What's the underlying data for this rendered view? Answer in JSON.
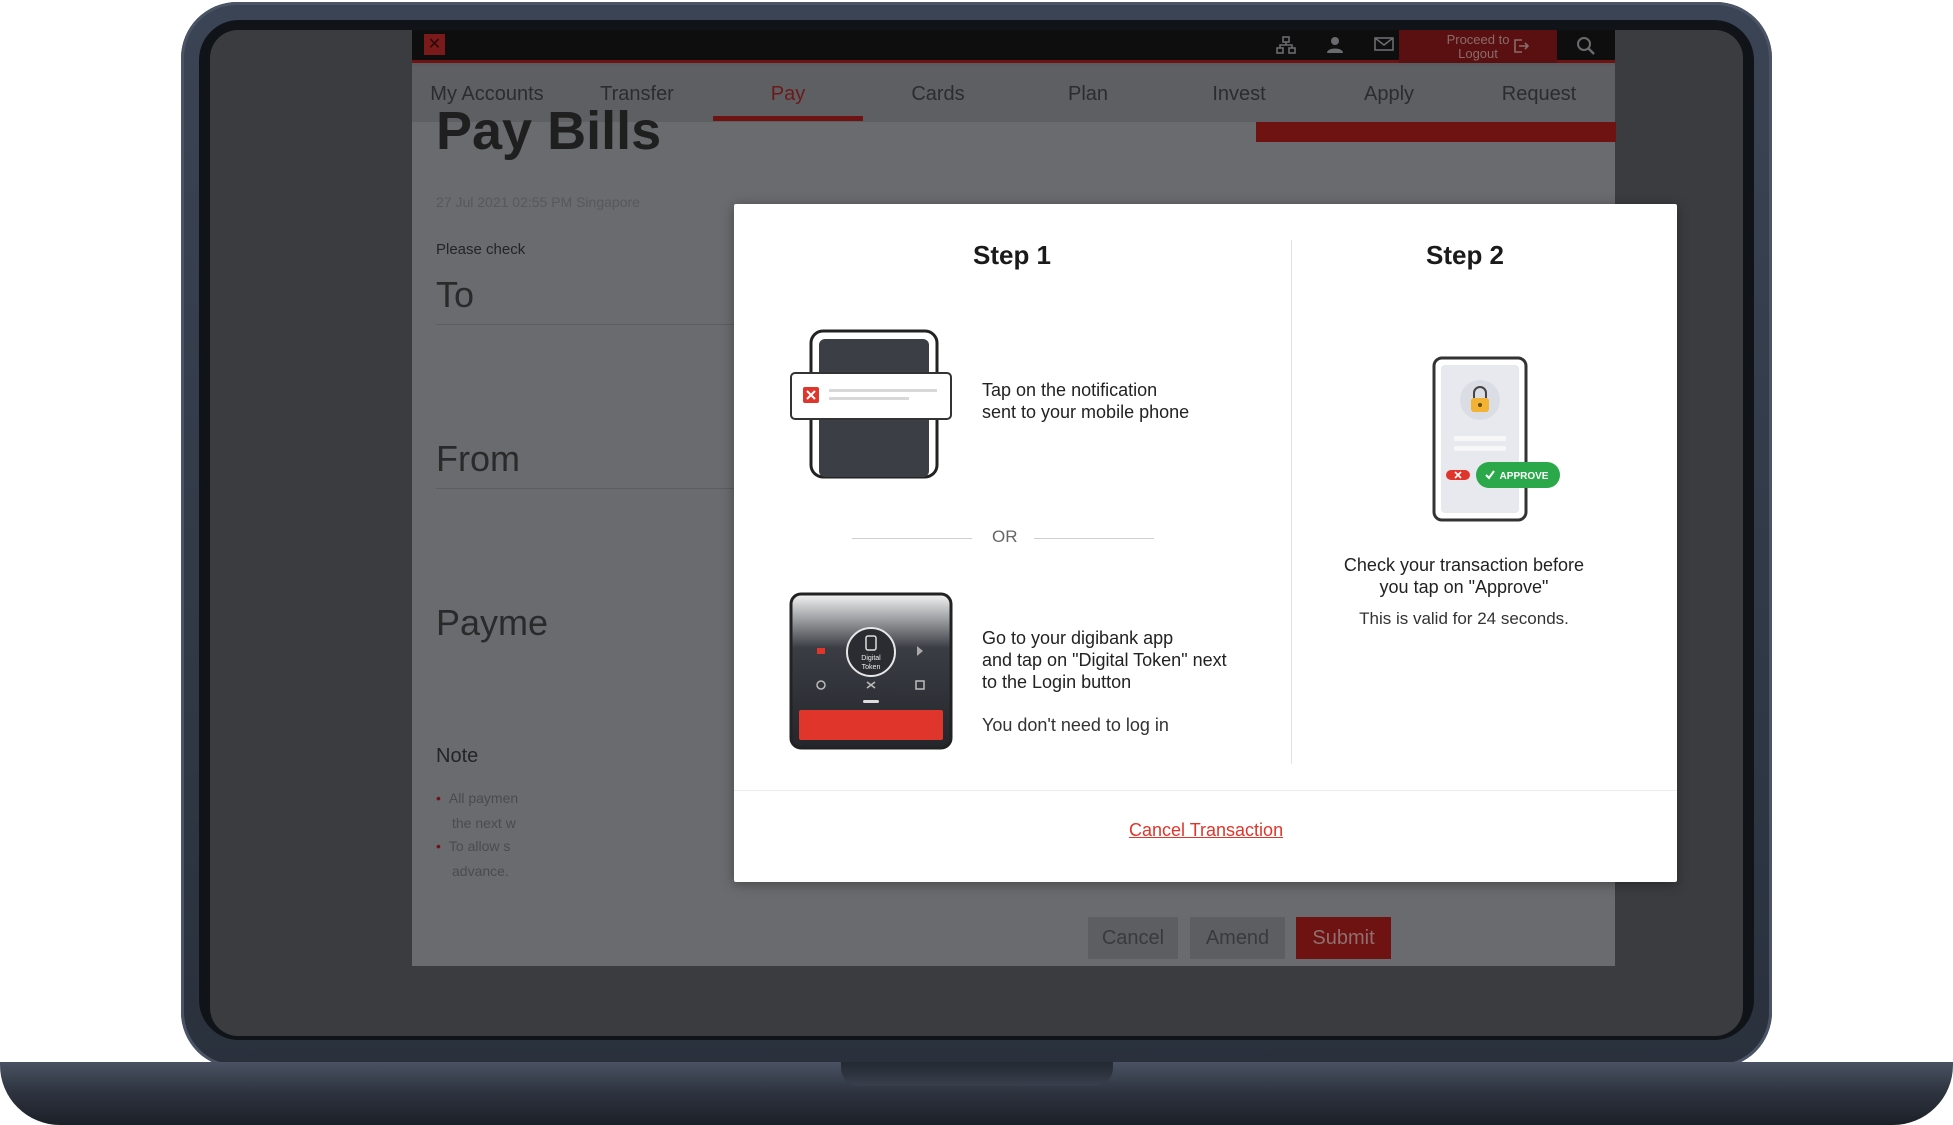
{
  "nav": {
    "items": [
      "My Accounts",
      "Transfer",
      "Pay",
      "Cards",
      "Plan",
      "Invest",
      "Apply",
      "Request"
    ],
    "active": "Pay"
  },
  "topbar": {
    "logout_label": "Proceed to Logout"
  },
  "page": {
    "title": "Pay Bills",
    "timestamp": "27 Jul 2021 02:55 PM Singapore",
    "check_text": "Please check",
    "to_label": "To",
    "from_label": "From",
    "payment_label": "Payme",
    "note_label": "Note",
    "note_bullet_1a": "All paymen",
    "note_bullet_1b": "the next w",
    "note_bullet_2a": "To allow s",
    "note_bullet_2b": "advance.",
    "cancel_label": "Cancel",
    "amend_label": "Amend",
    "submit_label": "Submit"
  },
  "modal": {
    "step1_title": "Step 1",
    "step2_title": "Step 2",
    "step1_instr_line1": "Tap on the notification",
    "step1_instr_line2": "sent to your mobile phone",
    "or_label": "OR",
    "step1_alt_line1": "Go to your digibank app",
    "step1_alt_line2": "and tap on \"Digital Token\" next",
    "step1_alt_line3": "to the Login button",
    "step1_alt_note": "You don't need to log in",
    "digital_token_label_1": "Digital",
    "digital_token_label_2": "Token",
    "approve_badge": "APPROVE",
    "step2_line1": "Check your transaction before",
    "step2_line2": "you tap on \"Approve\"",
    "step2_valid": "This is valid for 24 seconds.",
    "cancel_link": "Cancel Transaction"
  },
  "colors": {
    "brand_red": "#e0352b",
    "approve_green": "#2aa84a"
  }
}
